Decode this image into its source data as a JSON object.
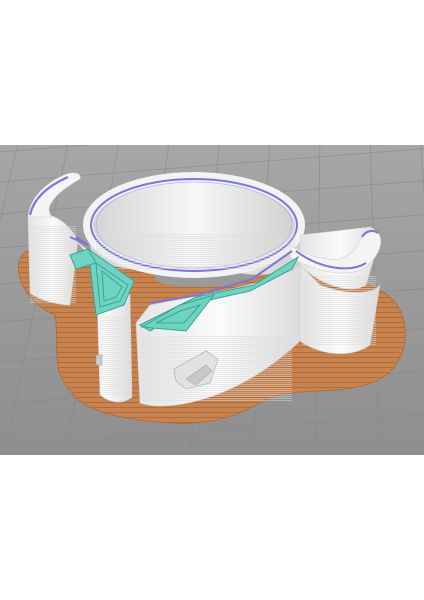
{
  "scene": {
    "subject": "3d-printed-pipe-clamp-slicer-preview",
    "colors": {
      "page_background": "#ffffff",
      "build_plate": "#9c9c9c",
      "grid_lines": "#868686",
      "brim": "#c9834f",
      "brim_lines": "#a8683b",
      "outer_wall": "#f2f2f2",
      "wall_shadow": "#d6d6d6",
      "inner_wall": "#7a78d6",
      "infill": "#6fd3c2",
      "infill_lines": "#3aa596"
    }
  }
}
